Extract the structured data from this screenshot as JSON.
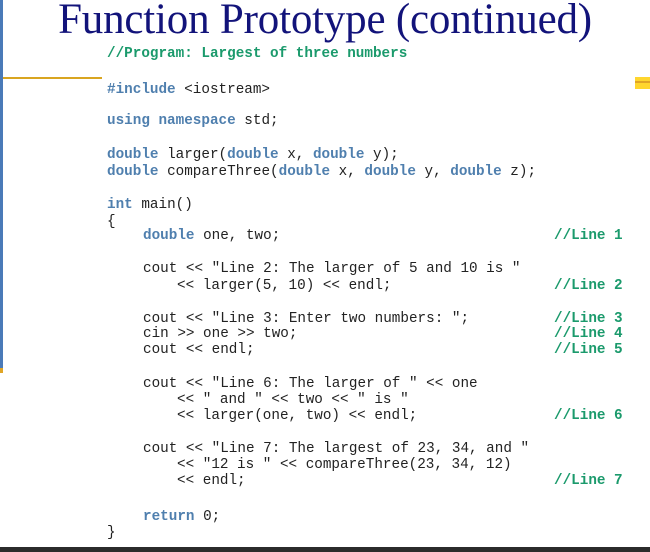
{
  "slide": {
    "title": "Function Prototype (continued)"
  },
  "colors": {
    "title": "#12137a",
    "keyword": "#4f7fae",
    "comment": "#1b9a6c",
    "code": "#222222",
    "left_bar": "#4a7ab8",
    "accent": "#d9a520",
    "accent_square": "#ffd62e"
  },
  "code": {
    "header_comment": "//Program: Largest of three numbers",
    "include_kw": "#include",
    "include_rest": " <iostream>",
    "using_kw": "using namespace",
    "using_rest": " std;",
    "proto1": {
      "kw1": "double",
      "t1": " larger(",
      "kw2": "double",
      "t2": " x, ",
      "kw3": "double",
      "t3": " y);"
    },
    "proto2": {
      "kw1": "double",
      "t1": " compareThree(",
      "kw2": "double",
      "t2": " x, ",
      "kw3": "double",
      "t3": " y, ",
      "kw4": "double",
      "t4": " z);"
    },
    "main_kw": "int",
    "main_rest": " main()",
    "open_brace": "{",
    "decl_kw": "double",
    "decl_rest": " one, two;",
    "l2a": "cout << \"Line 2: The larger of 5 and 10 is \"",
    "l2b": "<< larger(5, 10) << endl;",
    "l3": "cout << \"Line 3: Enter two numbers: \";",
    "l4": "cin >> one >> two;",
    "l5": "cout << endl;",
    "l6a": "cout << \"Line 6: The larger of \" << one",
    "l6b": "<< \" and \" << two << \" is \"",
    "l6c": "<< larger(one, two) << endl;",
    "l7a": "cout << \"Line 7: The largest of 23, 34, and \"",
    "l7b": "<< \"12 is \" << compareThree(23, 34, 12)",
    "l7c": "<< endl;",
    "return_kw": "return",
    "return_rest": " 0;",
    "close_brace": "}",
    "line_comments": {
      "c1": "//Line 1",
      "c2": "//Line 2",
      "c3": "//Line 3",
      "c4": "//Line 4",
      "c5": "//Line 5",
      "c6": "//Line 6",
      "c7": "//Line 7"
    }
  }
}
